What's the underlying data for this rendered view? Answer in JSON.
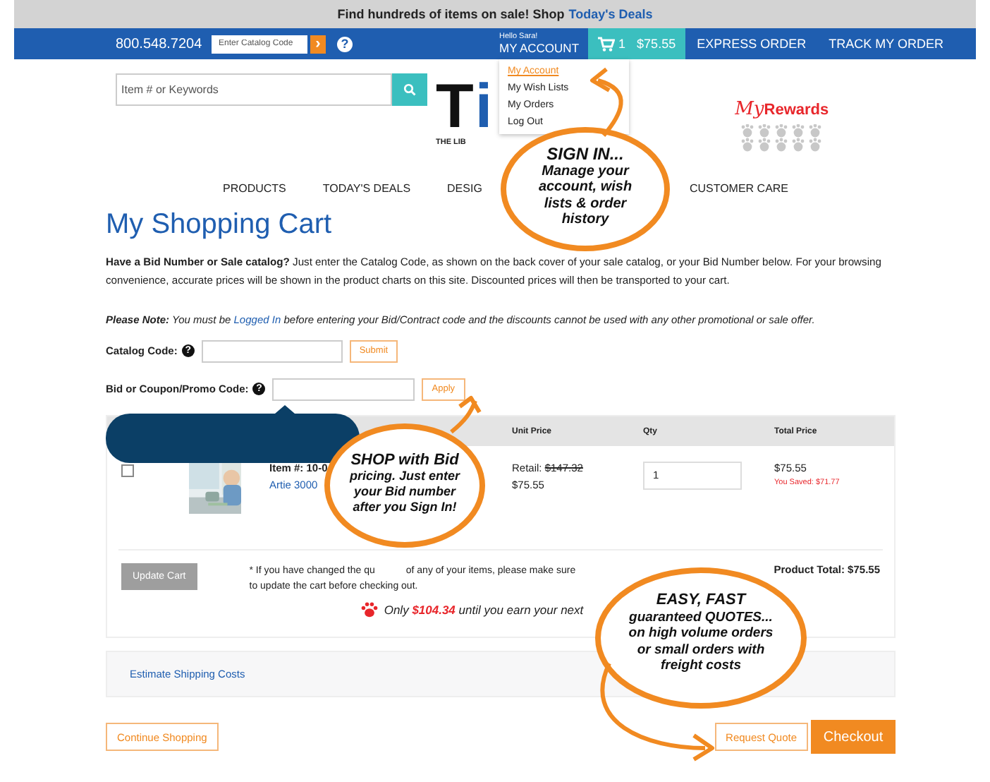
{
  "promo_bar": {
    "text": "Find hundreds of items on sale! Shop",
    "link": "Today's Deals"
  },
  "top_bar": {
    "phone": "800.548.7204",
    "catalog_placeholder": "Enter Catalog Code",
    "go": "›",
    "help": "?",
    "greeting": "Hello Sara!",
    "account": "MY ACCOUNT",
    "cart_count": "1",
    "cart_total": "$75.55",
    "links": [
      "EXPRESS ORDER",
      "TRACK MY ORDER"
    ]
  },
  "account_menu": [
    {
      "label": "My Account",
      "selected": true
    },
    {
      "label": "My Wish Lists",
      "selected": false
    },
    {
      "label": "My Orders",
      "selected": false
    },
    {
      "label": "Log Out",
      "selected": false
    }
  ],
  "search": {
    "placeholder": "Item # or Keywords"
  },
  "logo": {
    "t": "T",
    "i": "i",
    "tagline": "THE LIB"
  },
  "rewards": {
    "script": "My",
    "word": "Rewards"
  },
  "nav": [
    "PRODUCTS",
    "TODAY'S DEALS",
    "DESIG",
    "CUSTOMER CARE"
  ],
  "title": "My Shopping Cart",
  "intro": "**Have a Bid Number or Sale catalog?** Just enter the Catalog Code, as shown on the back cover of your sale catalog, or your Bid Number below. For your browsing convenience, accurate prices will be shown in the product charts on this site. Discounted prices will then be transported to your cart.",
  "note": {
    "lead": "Please Note:",
    "before": "You must be",
    "link": "Logged In",
    "after": "before entering your Bid/Contract code and the discounts cannot be used with any other promotional or sale offer."
  },
  "catalog_form": {
    "label": "Catalog Code:",
    "help": "?",
    "button": "Submit"
  },
  "bid_form": {
    "label": "Bid or Coupon/Promo Code:",
    "help": "?",
    "button": "Apply"
  },
  "table": {
    "columns": [
      "Unit Price",
      "Qty",
      "Total Price"
    ],
    "rows": [
      {
        "checked": false,
        "item_no": "Item #: 10-0",
        "name": "Artie 3000",
        "retail_label": "Retail:",
        "retail_price": "$147.32",
        "price": "$75.55",
        "qty": "1",
        "total": "$75.55",
        "saved": "You Saved: $71.77"
      }
    ]
  },
  "update_button": "Update Cart",
  "update_note": {
    "start": "* If you have changed the qu",
    "rest": "of any of your items, please make sure",
    "line2": "to update the cart before checking out."
  },
  "product_total": "Product Total: $75.55",
  "rewards_msg": {
    "prefix": "Only",
    "amount": "$104.34",
    "suffix": "until you earn your next"
  },
  "shipping_link": "Estimate Shipping Costs",
  "buttons": {
    "continue": "Continue Shopping",
    "quote": "Request Quote",
    "checkout": "Checkout"
  },
  "callouts": [
    {
      "lines": [
        "SIGN IN...",
        "Manage your",
        "account, wish",
        "lists & order",
        "history"
      ]
    },
    {
      "lines": [
        "SHOP with Bid",
        "pricing. Just enter",
        "your Bid number",
        "after you Sign In!"
      ]
    },
    {
      "lines": [
        "EASY, FAST",
        "guaranteed QUOTES...",
        "on high volume orders",
        "or small orders with",
        "freight costs"
      ]
    }
  ]
}
